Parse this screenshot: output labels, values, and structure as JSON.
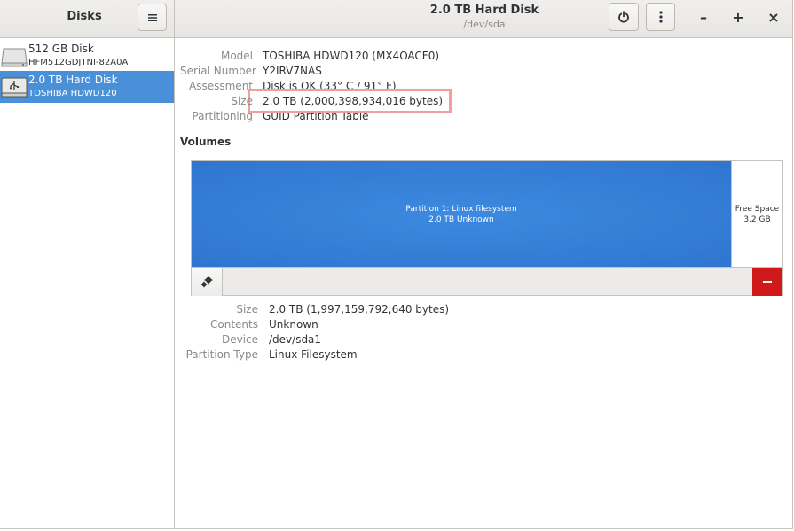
{
  "header": {
    "sidebar_title": "Disks",
    "title": "2.0 TB Hard Disk",
    "subtitle": "/dev/sda",
    "minimize_label": "–",
    "maximize_label": "+",
    "close_label": "×"
  },
  "sidebar": {
    "items": [
      {
        "name": "512 GB Disk",
        "model": "HFM512GDJTNI-82A0A",
        "selected": false
      },
      {
        "name": "2.0 TB Hard Disk",
        "model": "TOSHIBA HDWD120",
        "selected": true
      }
    ]
  },
  "drive_info": {
    "model_label": "Model",
    "model_value": "TOSHIBA HDWD120 (MX4OACF0)",
    "serial_label": "Serial Number",
    "serial_value": "Y2IRV7NAS",
    "assessment_label": "Assessment",
    "assessment_value": "Disk is OK (33° C / 91° F)",
    "size_label": "Size",
    "size_value": "2.0 TB (2,000,398,934,016 bytes)",
    "partitioning_label": "Partitioning",
    "partitioning_value": "GUID Partition Table"
  },
  "volumes": {
    "heading": "Volumes",
    "partition_line1": "Partition 1: Linux filesystem",
    "partition_line2": "2.0 TB Unknown",
    "free_line1": "Free Space",
    "free_line2": "3.2 GB"
  },
  "partition_info": {
    "size_label": "Size",
    "size_value": "2.0 TB (1,997,159,792,640 bytes)",
    "contents_label": "Contents",
    "contents_value": "Unknown",
    "device_label": "Device",
    "device_value": "/dev/sda1",
    "type_label": "Partition Type",
    "type_value": "Linux Filesystem"
  },
  "colors": {
    "accent": "#4a90d9",
    "partition": "#3584e4",
    "delete": "#d01a1a",
    "highlight": "#f29e9e"
  },
  "icons": {
    "menu": "hamburger-icon",
    "power": "power-icon",
    "more": "vertical-dots-icon",
    "disk": "hard-disk-icon",
    "gear": "gear-icon",
    "delete": "minus-icon"
  }
}
